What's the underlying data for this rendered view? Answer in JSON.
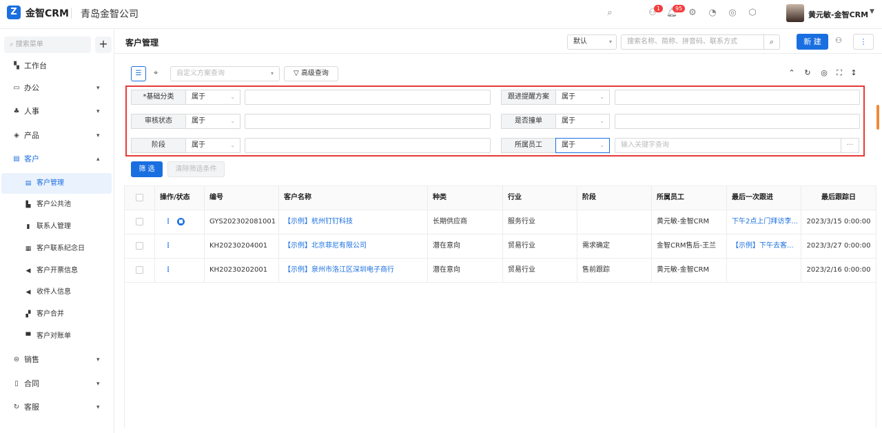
{
  "app": {
    "logo_glyph": "Z",
    "name": "金智CRM",
    "company": "青岛金智公司"
  },
  "topbar": {
    "icons": [
      "search-icon",
      "contacts-icon",
      "bell-icon",
      "settings-icon",
      "pie-chart-icon",
      "chrome-icon",
      "shield-icon"
    ],
    "contacts_badge": "1",
    "bell_badge": "95",
    "user_name": "黄元敏-金智CRM"
  },
  "sidebar": {
    "search_placeholder": "搜索菜单",
    "plus_label": "+",
    "items": [
      {
        "label": "工作台",
        "icon": "dashboard-icon",
        "caret": ""
      },
      {
        "label": "办公",
        "icon": "monitor-icon",
        "caret": "⌄"
      },
      {
        "label": "人事",
        "icon": "org-icon",
        "caret": "⌄"
      },
      {
        "label": "产品",
        "icon": "box-icon",
        "caret": "⌄"
      },
      {
        "label": "客户",
        "icon": "customer-icon",
        "caret": "⌃"
      },
      {
        "label": "销售",
        "icon": "sales-icon",
        "caret": "⌄"
      },
      {
        "label": "合同",
        "icon": "contract-icon",
        "caret": "⌄"
      },
      {
        "label": "客服",
        "icon": "service-icon",
        "caret": "⌄"
      }
    ],
    "sub_items": [
      {
        "label": "客户管理",
        "icon": "customer-list-icon"
      },
      {
        "label": "客户公共池",
        "icon": "pool-icon"
      },
      {
        "label": "联系人管理",
        "icon": "id-card-icon"
      },
      {
        "label": "客户联系纪念日",
        "icon": "calendar-icon"
      },
      {
        "label": "客户开票信息",
        "icon": "speaker-icon"
      },
      {
        "label": "收件人信息",
        "icon": "speaker-icon"
      },
      {
        "label": "客户合并",
        "icon": "merge-icon"
      },
      {
        "label": "客户对账单",
        "icon": "statement-icon"
      }
    ]
  },
  "header": {
    "title": "客户管理",
    "view_select": "默认",
    "search_placeholder": "搜索名称、简称、拼音码、联系方式",
    "new_button": "新 建",
    "more_button": "⋮"
  },
  "toolbar": {
    "scheme_placeholder": "自定义方案查询",
    "advanced_query": "高级查询"
  },
  "filters": {
    "rows": [
      {
        "left_label": "*基础分类",
        "left_op": "属于",
        "right_label": "跟进提醒方案",
        "right_op": "属于"
      },
      {
        "left_label": "审核状态",
        "left_op": "属于",
        "right_label": "是否撞单",
        "right_op": "属于"
      },
      {
        "left_label": "阶段",
        "left_op": "属于",
        "right_label": "所属员工",
        "right_op": "属于"
      }
    ],
    "employee_placeholder": "输入关键字查询",
    "filter_button": "筛 选",
    "clear_button": "清除筛选条件"
  },
  "table": {
    "columns": [
      "操作/状态",
      "编号",
      "客户名称",
      "种类",
      "行业",
      "阶段",
      "所属员工",
      "最后一次跟进",
      "最后跟踪日"
    ],
    "rows": [
      {
        "code": "GYS202302081001",
        "name": "【示例】杭州钉钉科技",
        "kind": "长期供应商",
        "industry": "服务行业",
        "stage": "",
        "employee": "黄元敏-金智CRM",
        "last_follow": "下午2点上门拜访李...",
        "last_date": "2023/3/15 0:00:00",
        "has_status": true
      },
      {
        "code": "KH20230204001",
        "name": "【示例】北京菲尼有限公司",
        "kind": "潜在意向",
        "industry": "贸易行业",
        "stage": "需求确定",
        "employee": "金智CRM售后-王兰",
        "last_follow": "【示例】下午去客...",
        "last_date": "2023/3/27 0:00:00",
        "has_status": false
      },
      {
        "code": "KH20230202001",
        "name": "【示例】泉州市洛江区深圳电子商行",
        "kind": "潜在意向",
        "industry": "贸易行业",
        "stage": "售前跟踪",
        "employee": "黄元敏-金智CRM",
        "last_follow": "",
        "last_date": "2023/2/16 0:00:00",
        "has_status": false
      }
    ]
  },
  "colors": {
    "accent": "#1a6fe0",
    "highlight_border": "#e53935",
    "badge": "#f23d3d"
  }
}
